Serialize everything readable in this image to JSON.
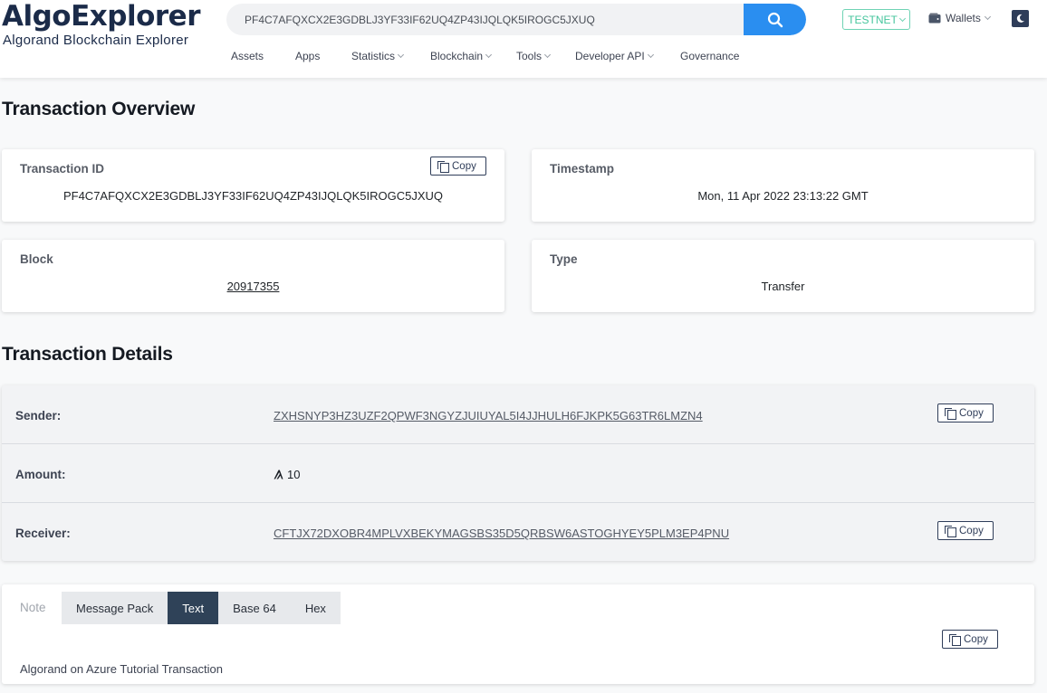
{
  "header": {
    "logo_title": "AlgoExplorer",
    "logo_subtitle": "Algorand Blockchain Explorer",
    "search_value": "PF4C7AFQXCX2E3GDBLJ3YF33IF62UQ4ZP43IJQLQK5IROGC5JXUQ",
    "network": "TESTNET",
    "wallets_label": "Wallets",
    "nav": [
      {
        "label": "Assets",
        "dropdown": false
      },
      {
        "label": "Apps",
        "dropdown": false
      },
      {
        "label": "Statistics",
        "dropdown": true
      },
      {
        "label": "Blockchain",
        "dropdown": true
      },
      {
        "label": "Tools",
        "dropdown": true
      },
      {
        "label": "Developer API",
        "dropdown": true
      },
      {
        "label": "Governance",
        "dropdown": false
      }
    ],
    "icons": [
      "search-icon",
      "chevron-down-icon",
      "wallet-icon",
      "moon-icon"
    ]
  },
  "overview": {
    "heading": "Transaction Overview",
    "transaction_id_label": "Transaction ID",
    "transaction_id": "PF4C7AFQXCX2E3GDBLJ3YF33IF62UQ4ZP43IJQLQK5IROGC5JXUQ",
    "timestamp_label": "Timestamp",
    "timestamp": "Mon, 11 Apr 2022 23:13:22 GMT",
    "block_label": "Block",
    "block": "20917355",
    "type_label": "Type",
    "type": "Transfer",
    "copy_label": "Copy"
  },
  "details": {
    "heading": "Transaction Details",
    "sender_label": "Sender:",
    "sender": "ZXHSNYP3HZ3UZF2QPWF3NGYZJUIUYAL5I4JJHULH6FJKPK5G63TR6LMZN4",
    "amount_label": "Amount:",
    "amount": "10",
    "receiver_label": "Receiver:",
    "receiver": "CFTJX72DXOBR4MPLVXBEKYMAGSBS35D5QRBSW6ASTOGHYEY5PLM3EP4PNU",
    "copy_label": "Copy"
  },
  "note": {
    "label": "Note",
    "tabs": [
      "Message Pack",
      "Text",
      "Base 64",
      "Hex"
    ],
    "active_tab": "Text",
    "text": "Algorand on Azure Tutorial Transaction",
    "copy_label": "Copy"
  },
  "colors": {
    "brand_navy": "#1b2b49",
    "search_button": "#2a8ef0",
    "testnet_green": "#46c59d",
    "active_tab": "#2f4258"
  }
}
